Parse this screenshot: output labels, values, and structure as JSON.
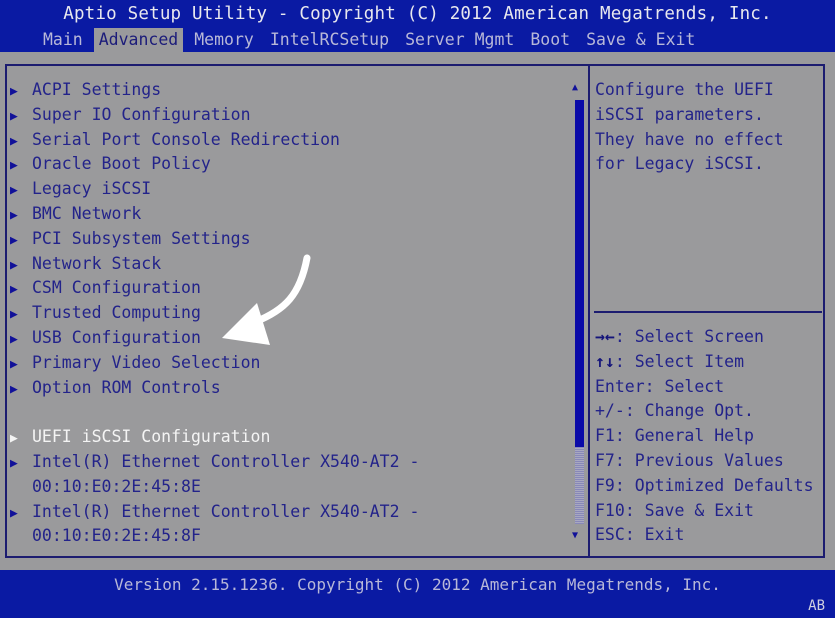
{
  "header": {
    "title": "Aptio Setup Utility - Copyright (C) 2012 American Megatrends, Inc.",
    "tabs": [
      {
        "label": "Main",
        "active": false
      },
      {
        "label": "Advanced",
        "active": true
      },
      {
        "label": "Memory",
        "active": false
      },
      {
        "label": "IntelRCSetup",
        "active": false
      },
      {
        "label": "Server Mgmt",
        "active": false
      },
      {
        "label": "Boot",
        "active": false
      },
      {
        "label": "Save & Exit",
        "active": false
      }
    ]
  },
  "menu": {
    "items": [
      {
        "label": "ACPI Settings",
        "arrow": "▶"
      },
      {
        "label": "Super IO Configuration",
        "arrow": "▶"
      },
      {
        "label": "Serial Port Console Redirection",
        "arrow": "▶"
      },
      {
        "label": "Oracle Boot Policy",
        "arrow": "▶"
      },
      {
        "label": "Legacy iSCSI",
        "arrow": "▶"
      },
      {
        "label": "BMC Network",
        "arrow": "▶"
      },
      {
        "label": "PCI Subsystem Settings",
        "arrow": "▶"
      },
      {
        "label": "Network Stack",
        "arrow": "▶"
      },
      {
        "label": "CSM Configuration",
        "arrow": "▶"
      },
      {
        "label": "Trusted Computing",
        "arrow": "▶"
      },
      {
        "label": "USB Configuration",
        "arrow": "▶"
      },
      {
        "label": "Primary Video Selection",
        "arrow": "▶"
      },
      {
        "label": "Option ROM Controls",
        "arrow": "▶"
      },
      {
        "label": "UEFI iSCSI Configuration",
        "arrow": "▶",
        "selected": true
      },
      {
        "label": "Intel(R) Ethernet Controller X540-AT2 -",
        "continuation": "00:10:E0:2E:45:8E",
        "arrow": "▶"
      },
      {
        "label": "Intel(R) Ethernet Controller X540-AT2 -",
        "continuation": "00:10:E0:2E:45:8F",
        "arrow": "▶"
      }
    ],
    "selected_index": 13
  },
  "scrollbar": {
    "up_icon": "▲",
    "down_icon": "▼",
    "position_fraction": 0.82
  },
  "help": {
    "lines": [
      "Configure the UEFI",
      "iSCSI parameters.",
      "They have no effect",
      "for Legacy iSCSI."
    ]
  },
  "keys": [
    {
      "key": "→←",
      "text": ": Select Screen"
    },
    {
      "key": "↑↓",
      "text": ": Select Item"
    },
    {
      "key": "Enter",
      "text": ": Select"
    },
    {
      "key": "+/-",
      "text": ": Change Opt."
    },
    {
      "key": "F1",
      "text": ": General Help"
    },
    {
      "key": "F7",
      "text": ": Previous Values"
    },
    {
      "key": "F9",
      "text": ": Optimized Defaults"
    },
    {
      "key": "F10",
      "text": ": Save & Exit"
    },
    {
      "key": "ESC",
      "text": ": Exit"
    }
  ],
  "footer": {
    "version": "Version 2.15.1236. Copyright (C) 2012 American Megatrends, Inc.",
    "corner": "AB"
  },
  "annotation": {
    "type": "curved-arrow",
    "pointing_to": "USB Configuration",
    "color": "#ffffff"
  }
}
